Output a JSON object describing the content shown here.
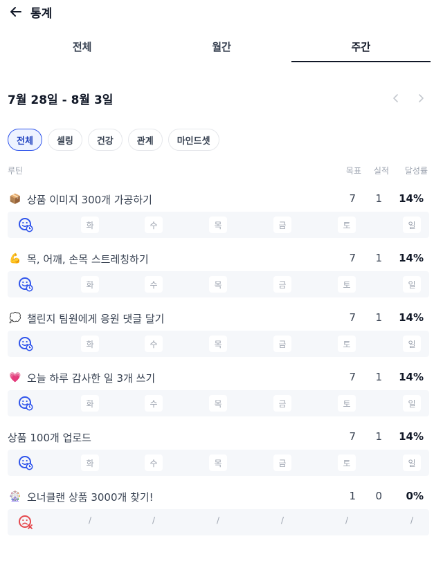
{
  "header": {
    "title": "통계",
    "back_icon": "arrow-left-icon"
  },
  "tabs": [
    {
      "label": "전체",
      "active": false
    },
    {
      "label": "월간",
      "active": false
    },
    {
      "label": "주간",
      "active": true
    }
  ],
  "week": {
    "range": "7월 28일 - 8월 3일"
  },
  "filters": [
    {
      "label": "전체",
      "active": true
    },
    {
      "label": "셀링",
      "active": false
    },
    {
      "label": "건강",
      "active": false
    },
    {
      "label": "관계",
      "active": false
    },
    {
      "label": "마인드셋",
      "active": false
    }
  ],
  "table": {
    "col_routine": "루틴",
    "col_goal": "목표",
    "col_actual": "실적",
    "col_rate": "달성률"
  },
  "days": [
    "화",
    "수",
    "목",
    "금",
    "토",
    "일"
  ],
  "routines": [
    {
      "emoji": "📦",
      "name": "상품 이미지 300개 가공하기",
      "goal": "7",
      "actual": "1",
      "rate": "14%",
      "status_icon": "smile-clock-icon"
    },
    {
      "emoji": "💪",
      "name": "목, 어깨, 손목 스트레칭하기",
      "goal": "7",
      "actual": "1",
      "rate": "14%",
      "status_icon": "smile-clock-icon"
    },
    {
      "emoji": "💭",
      "name": "챌린지 팀원에게 응원 댓글 달기",
      "goal": "7",
      "actual": "1",
      "rate": "14%",
      "status_icon": "smile-clock-icon"
    },
    {
      "emoji": "💗",
      "name": "오늘 하루 감사한 일 3개 쓰기",
      "goal": "7",
      "actual": "1",
      "rate": "14%",
      "status_icon": "smile-clock-icon"
    },
    {
      "emoji": "",
      "name": "상품 100개 업로드",
      "goal": "7",
      "actual": "1",
      "rate": "14%",
      "status_icon": "smile-clock-icon"
    },
    {
      "emoji": "🎡",
      "name": "오너클랜 상품 3000개 찾기!",
      "goal": "1",
      "actual": "0",
      "rate": "0%",
      "status_icon": "sad-x-icon"
    }
  ],
  "inactive_mark": "/",
  "colors": {
    "accent": "#2f54eb",
    "failed": "#e5484d",
    "strip": "#f5f7fa"
  }
}
